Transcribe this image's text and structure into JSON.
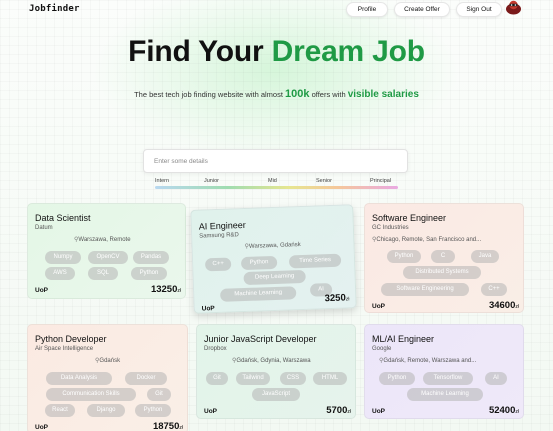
{
  "app": {
    "logo": "Jobfinder"
  },
  "nav": {
    "profile": "Profile",
    "create_offer": "Create Offer",
    "sign_out": "Sign Out"
  },
  "hero": {
    "title_part1": "Find Your ",
    "title_part2": "Dream Job",
    "sub_before": "The best tech job finding website with almost ",
    "sub_number": "100k",
    "sub_middle": " offers with ",
    "sub_highlight": "visible salaries"
  },
  "search": {
    "placeholder": "Enter some details"
  },
  "levels": [
    "Intern",
    "Junior",
    "Mid",
    "Senior",
    "Principal"
  ],
  "currency": "zł",
  "cards": [
    {
      "title": "Data Scientist",
      "company": "Datum",
      "location": "Warszawa, Remote",
      "tags": [
        "Numpy",
        "OpenCV",
        "Pandas",
        "AWS",
        "SQL",
        "Python"
      ],
      "contract": "UoP",
      "salary": "13250"
    },
    {
      "title": "AI Engineer",
      "company": "Samsung R&D",
      "location": "Warszawa, Gdańsk",
      "tags": [
        "C++",
        "Python",
        "Time Series",
        "Deep Learning",
        "Machine Learning",
        "AI"
      ],
      "contract": "UoP",
      "salary": "3250"
    },
    {
      "title": "Software Engineer",
      "company": "GC Industries",
      "location": "Chicago, Remote, San Francisco and...",
      "tags": [
        "Python",
        "C",
        "Java",
        "Distributed Systems",
        "Software Engineering",
        "C++"
      ],
      "contract": "UoP",
      "salary": "34600"
    },
    {
      "title": "Python Developer",
      "company": "Air Space Intelligence",
      "location": "Gdańsk",
      "tags": [
        "Data Analysis",
        "Docker",
        "Communication Skills",
        "Git",
        "React",
        "Django",
        "Python"
      ],
      "contract": "UoP",
      "salary": "18750"
    },
    {
      "title": "Junior JavaScript Developer",
      "company": "Dropbox",
      "location": "Gdańsk, Gdynia, Warszawa",
      "tags": [
        "Git",
        "Tailwind",
        "CSS",
        "HTML",
        "JavaScript"
      ],
      "contract": "UoP",
      "salary": "5700"
    },
    {
      "title": "ML/AI Engineer",
      "company": "Google",
      "location": "Gdańsk, Remote, Warszawa and...",
      "tags": [
        "Python",
        "Tensorflow",
        "AI",
        "Machine Learning"
      ],
      "contract": "UoP",
      "salary": "52400"
    }
  ]
}
